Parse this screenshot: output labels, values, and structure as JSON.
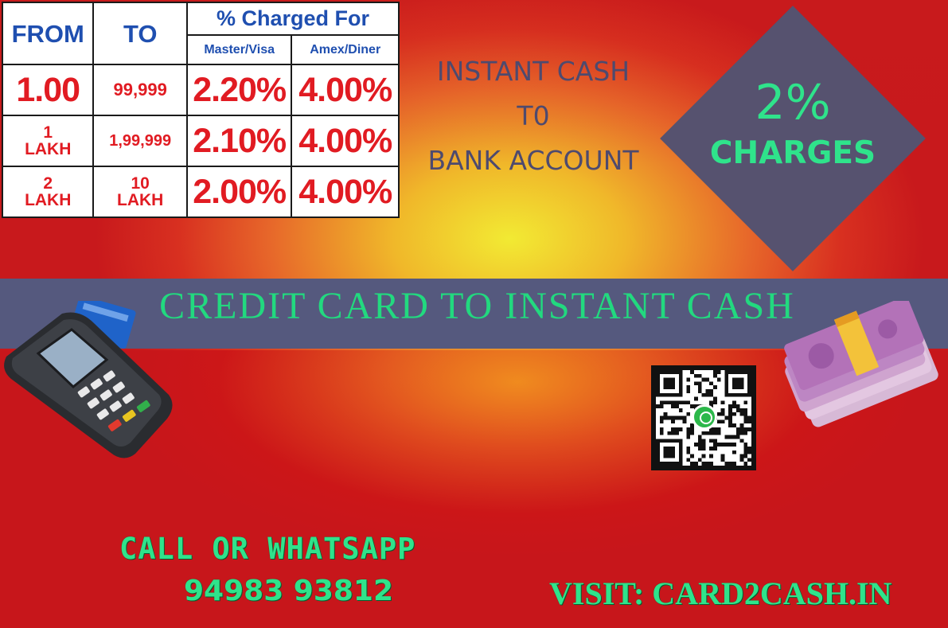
{
  "rate_table": {
    "headers": {
      "from": "FROM",
      "to": "TO",
      "charged_for": "% Charged For",
      "master_visa": "Master/Visa",
      "amex_diner": "Amex/Diner"
    },
    "rows": [
      {
        "from": "1.00",
        "to": "99,999",
        "master_visa": "2.20%",
        "amex_diner": "4.00%"
      },
      {
        "from_num": "1",
        "from_unit": "LAKH",
        "to": "1,99,999",
        "master_visa": "2.10%",
        "amex_diner": "4.00%"
      },
      {
        "from_num": "2",
        "from_unit": "LAKH",
        "to_num": "10",
        "to_unit": "LAKH",
        "master_visa": "2.00%",
        "amex_diner": "4.00%"
      }
    ]
  },
  "headline": {
    "line1": "INSTANT CASH",
    "line2": "T0",
    "line3": "BANK ACCOUNT"
  },
  "badge": {
    "percent": "2%",
    "label": "CHARGES",
    "color": "#2fe38b"
  },
  "banner": {
    "text": "CREDIT CARD TO INSTANT CASH"
  },
  "contact": {
    "call_label": "CALL OR WHATSAPP",
    "phone": "94983 93812",
    "visit": "VISIT: CARD2CASH.IN"
  },
  "icons": {
    "pos": "card-machine-icon",
    "cash": "cash-bundle-icon",
    "qr": "qr-code-icon",
    "whatsapp": "whatsapp-icon"
  },
  "colors": {
    "accent_green": "#2fe38b",
    "table_blue": "#1f4fb0",
    "table_red": "#e11b22",
    "banner_bg": "#55597e"
  }
}
